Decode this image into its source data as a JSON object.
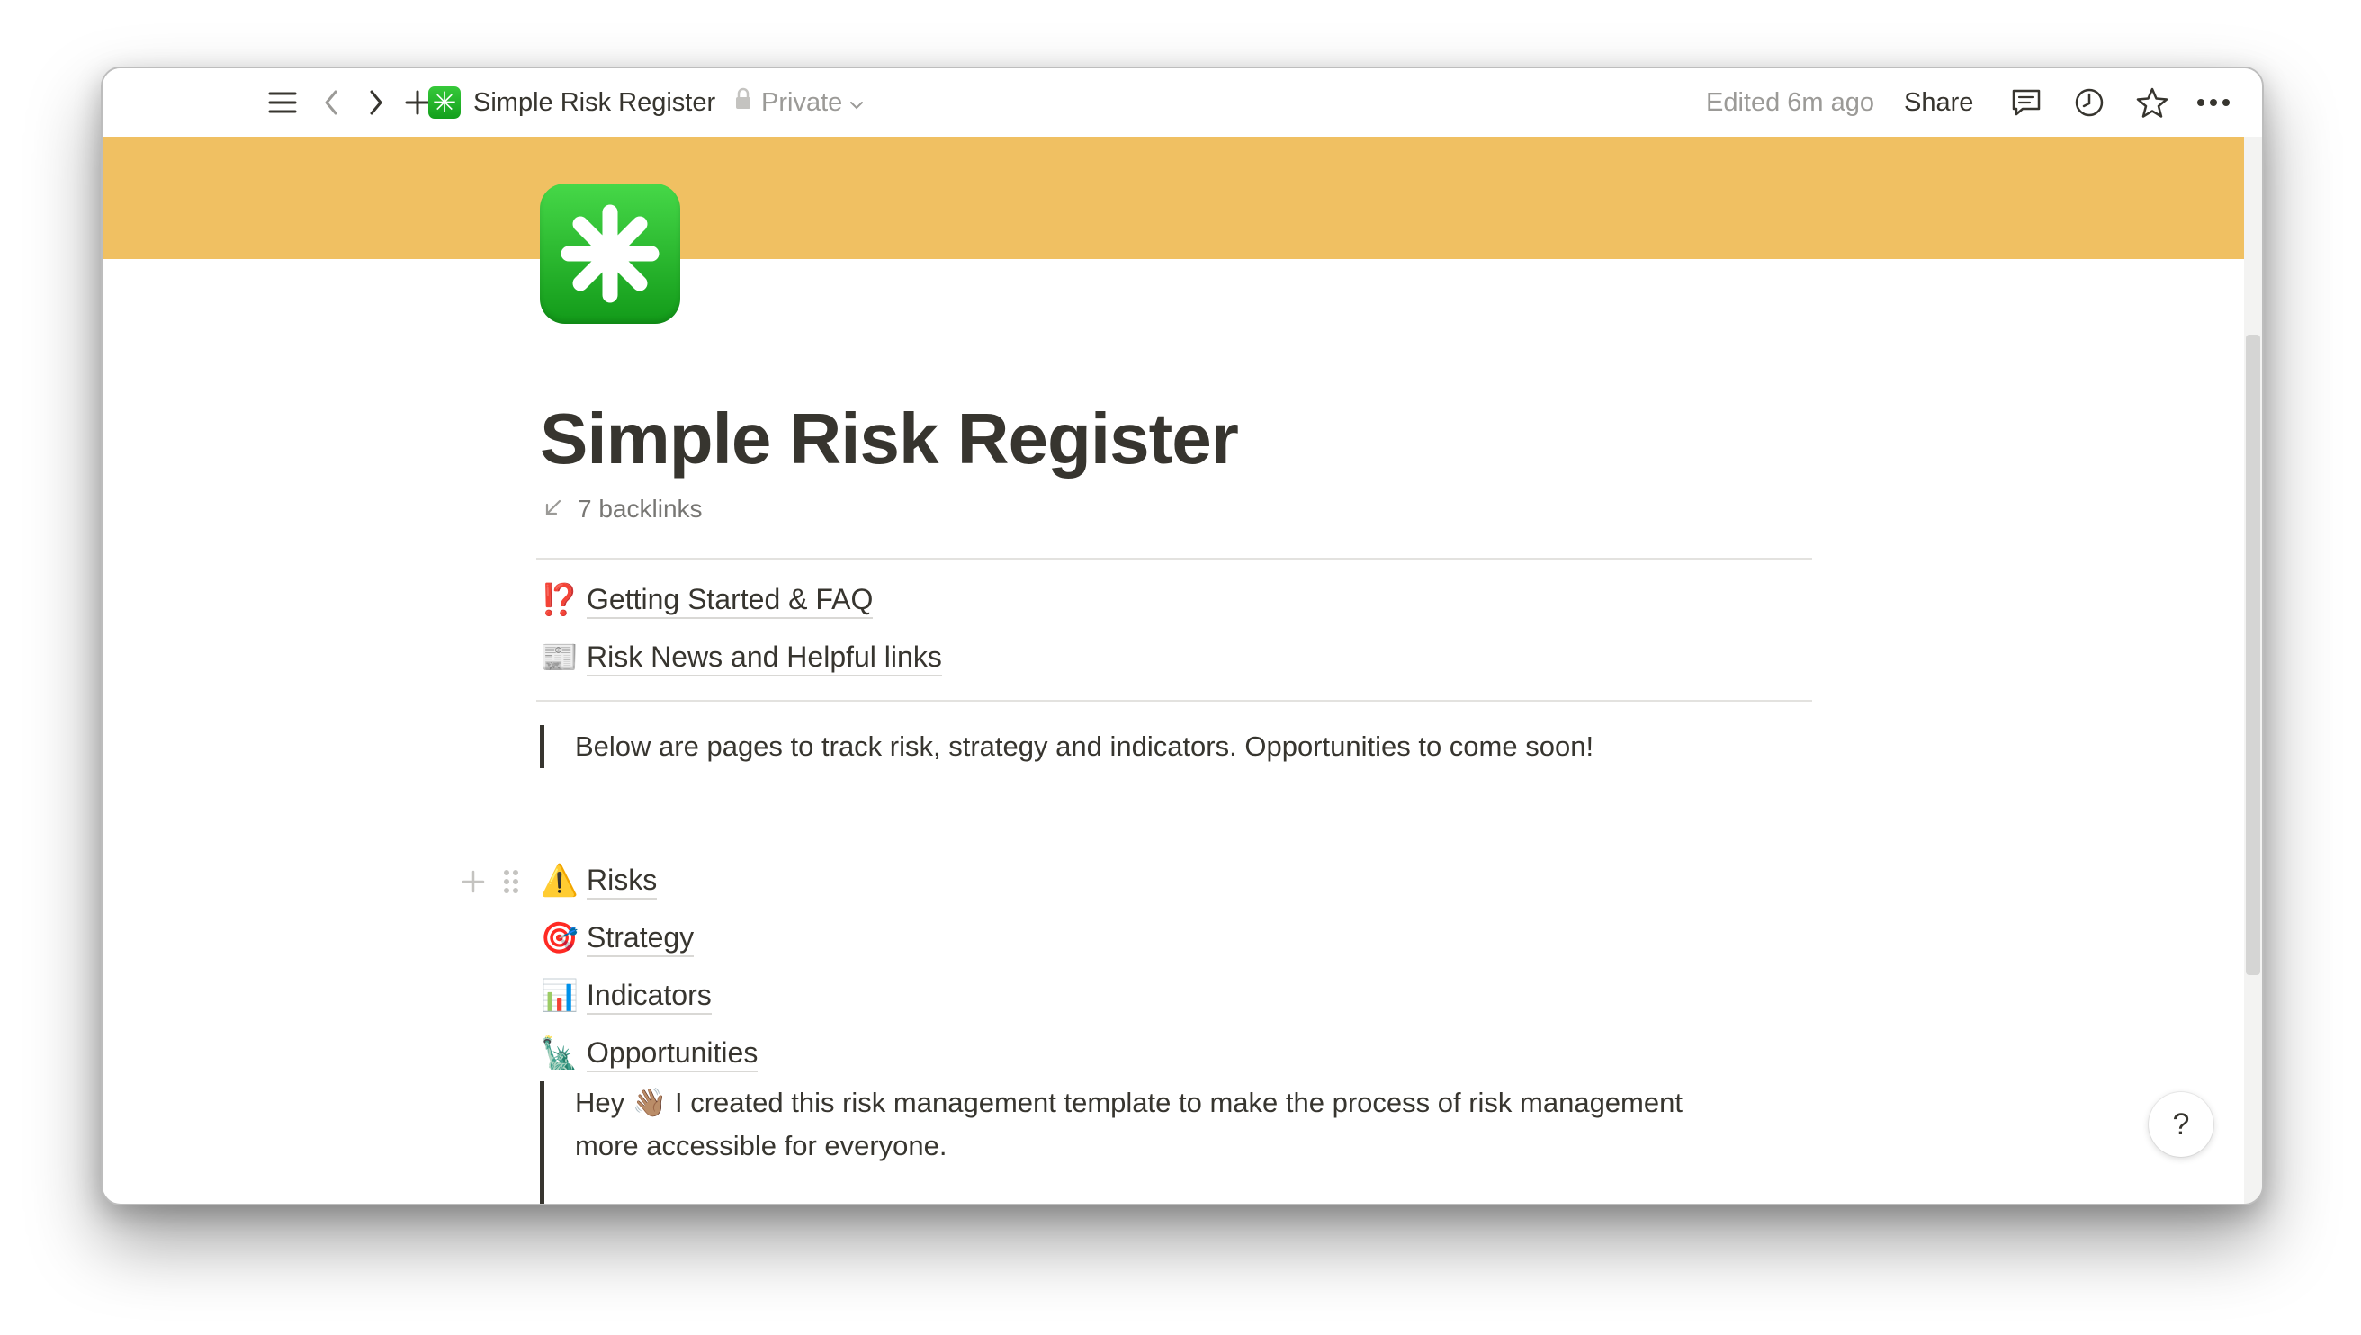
{
  "topbar": {
    "page_title": "Simple Risk Register",
    "privacy": "Private",
    "edited": "Edited 6m ago",
    "share": "Share"
  },
  "page": {
    "title": "Simple Risk Register",
    "backlinks": "7 backlinks",
    "cover_color": "#f0c062",
    "icon_color": "#1fb626"
  },
  "top_links": [
    {
      "emoji": "⁉️",
      "label": "Getting Started & FAQ"
    },
    {
      "emoji": "📰",
      "label": "Risk News and Helpful links"
    }
  ],
  "callout": "Below are pages to track risk, strategy and indicators. Opportunities to come soon!",
  "sections": [
    {
      "emoji": "⚠️",
      "label": "Risks"
    },
    {
      "emoji": "🎯",
      "label": "Strategy"
    },
    {
      "emoji": "📊",
      "label": "Indicators"
    },
    {
      "emoji": "🗽",
      "label": "Opportunities"
    }
  ],
  "intro": {
    "hey": "Hey",
    "wave": "👋🏽",
    "line1": "I created this risk management template to make the process of risk management",
    "line2": "more accessible for everyone."
  },
  "help": "?"
}
